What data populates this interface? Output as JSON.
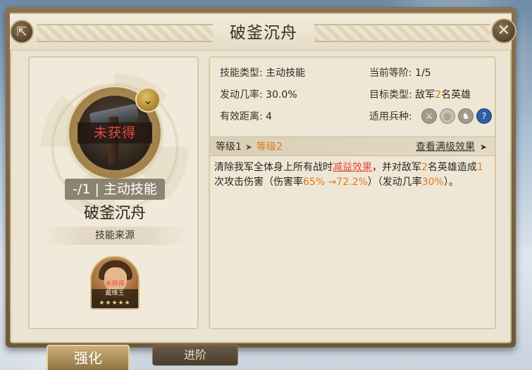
{
  "title": "破釜沉舟",
  "skill": {
    "locked_text": "未获得",
    "level_type_text": "-/1 | 主动技能",
    "name": "破釜沉舟",
    "source_label": "技能来源"
  },
  "hero": {
    "status": "未获得",
    "name": "戴维王",
    "stars": "★★★★★"
  },
  "info": {
    "skill_type_label": "技能类型:",
    "skill_type_value": "主动技能",
    "current_tier_label": "当前等阶:",
    "current_tier_value": "1/5",
    "trigger_rate_label": "发动几率:",
    "trigger_rate_value": "30.0%",
    "target_type_label": "目标类型:",
    "target_type_prefix": "敌军",
    "target_type_num": "2",
    "target_type_suffix": "名英雄",
    "range_label": "有效距离:",
    "range_value": "4",
    "unit_types_label": "适用兵种:",
    "unit_icons": [
      "sword-icon",
      "bow-target-icon",
      "horse-icon",
      "question-icon"
    ]
  },
  "level_bar": {
    "current": "等级1",
    "arrow": "➤",
    "next": "等级2",
    "view_max": "查看满级效果",
    "view_max_arrow": "➤"
  },
  "description": {
    "p1": "清除我军全体身上所有战时",
    "p2_red": "减益效果",
    "p3": "，并对敌军",
    "p4_orange": "2",
    "p5": "名英雄造成",
    "p6_orange": "1",
    "p7": "次攻击伤害（伤害率",
    "p8_orange": "65% →72.2%",
    "p9": "）（发动几率",
    "p10_orange": "30%",
    "p11": "）。"
  },
  "tabs": {
    "strengthen": "强化",
    "advance": "进阶"
  },
  "colors": {
    "accent_orange": "#e07a1a",
    "locked_red": "#e44a3c",
    "panel_bg": "#ece4d2"
  }
}
